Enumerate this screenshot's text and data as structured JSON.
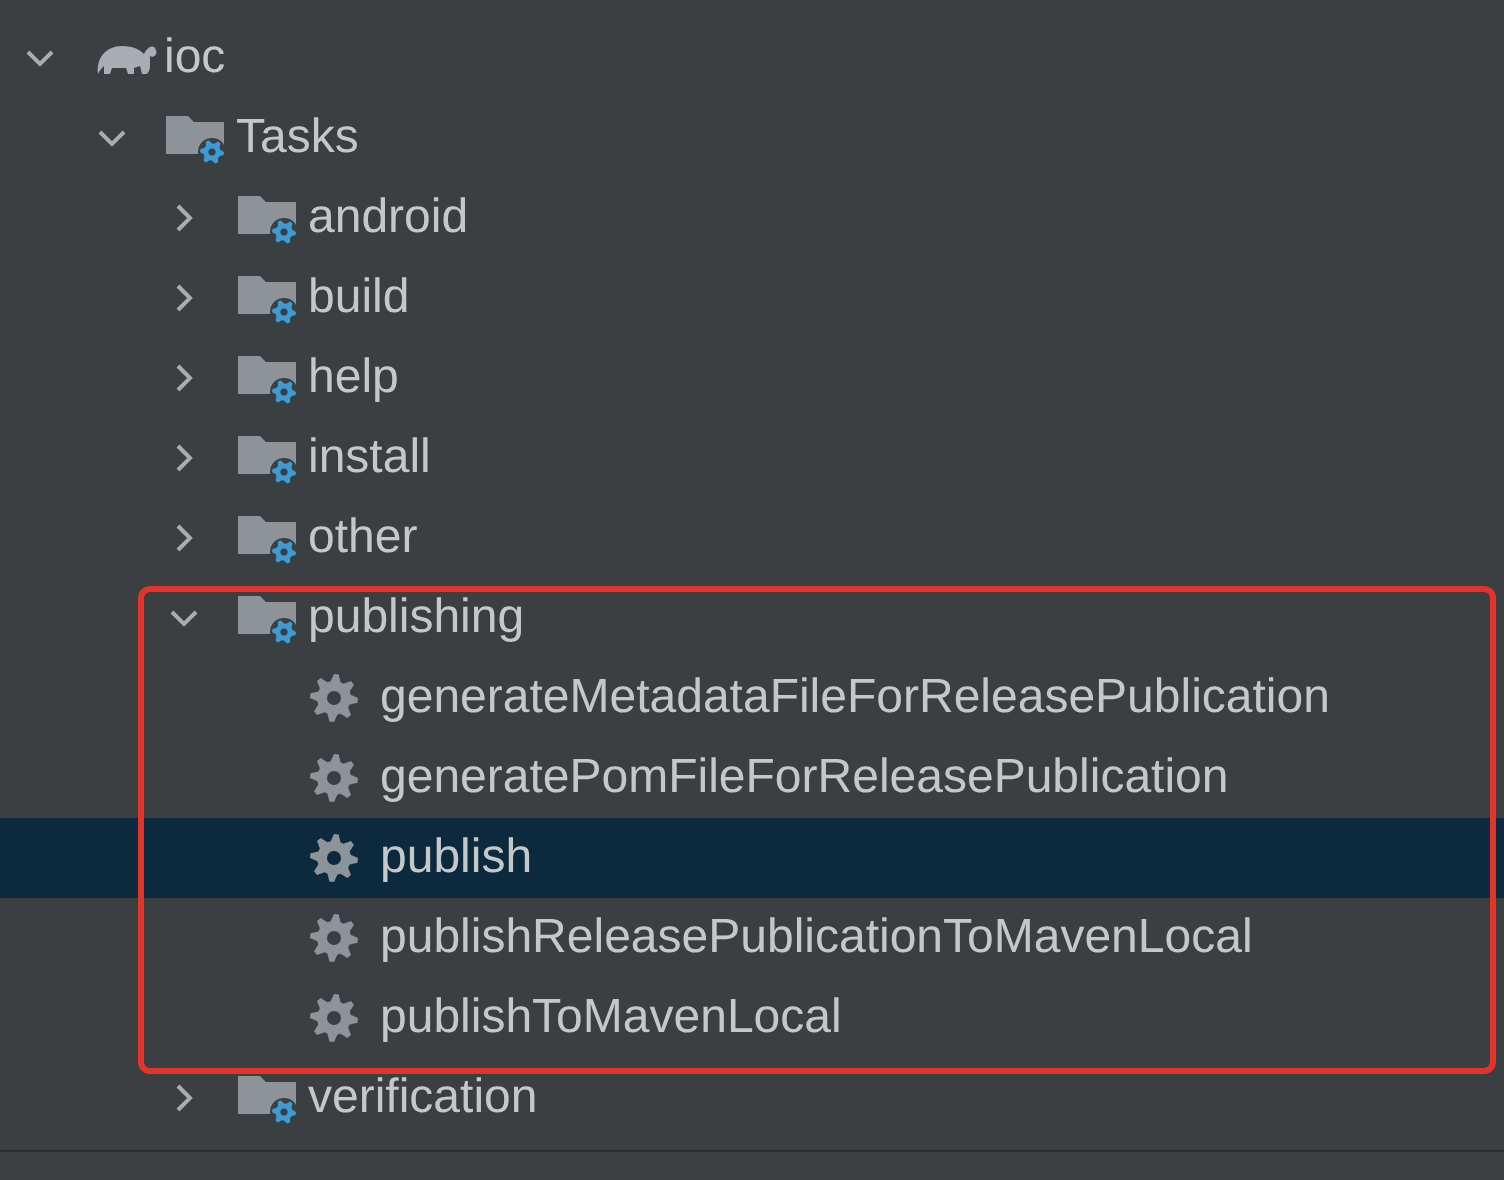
{
  "tree": [
    {
      "label": "ioc",
      "kind": "project",
      "expanded": true,
      "selected": false,
      "highlighted": false,
      "children": [
        {
          "label": "Tasks",
          "kind": "folder",
          "expanded": true,
          "selected": false,
          "highlighted": false,
          "children": [
            {
              "label": "android",
              "kind": "folder",
              "expanded": false,
              "selected": false,
              "highlighted": false
            },
            {
              "label": "build",
              "kind": "folder",
              "expanded": false,
              "selected": false,
              "highlighted": false
            },
            {
              "label": "help",
              "kind": "folder",
              "expanded": false,
              "selected": false,
              "highlighted": false
            },
            {
              "label": "install",
              "kind": "folder",
              "expanded": false,
              "selected": false,
              "highlighted": false
            },
            {
              "label": "other",
              "kind": "folder",
              "expanded": false,
              "selected": false,
              "highlighted": false
            },
            {
              "label": "publishing",
              "kind": "folder",
              "expanded": true,
              "selected": false,
              "highlighted": true,
              "children": [
                {
                  "label": "generateMetadataFileForReleasePublication",
                  "kind": "task",
                  "selected": false,
                  "highlighted": false
                },
                {
                  "label": "generatePomFileForReleasePublication",
                  "kind": "task",
                  "selected": false,
                  "highlighted": false
                },
                {
                  "label": "publish",
                  "kind": "task",
                  "selected": true,
                  "highlighted": false
                },
                {
                  "label": "publishReleasePublicationToMavenLocal",
                  "kind": "task",
                  "selected": false,
                  "highlighted": false
                },
                {
                  "label": "publishToMavenLocal",
                  "kind": "task",
                  "selected": false,
                  "highlighted": false
                }
              ]
            },
            {
              "label": "verification",
              "kind": "folder",
              "expanded": false,
              "selected": false,
              "highlighted": false
            }
          ]
        }
      ]
    }
  ]
}
